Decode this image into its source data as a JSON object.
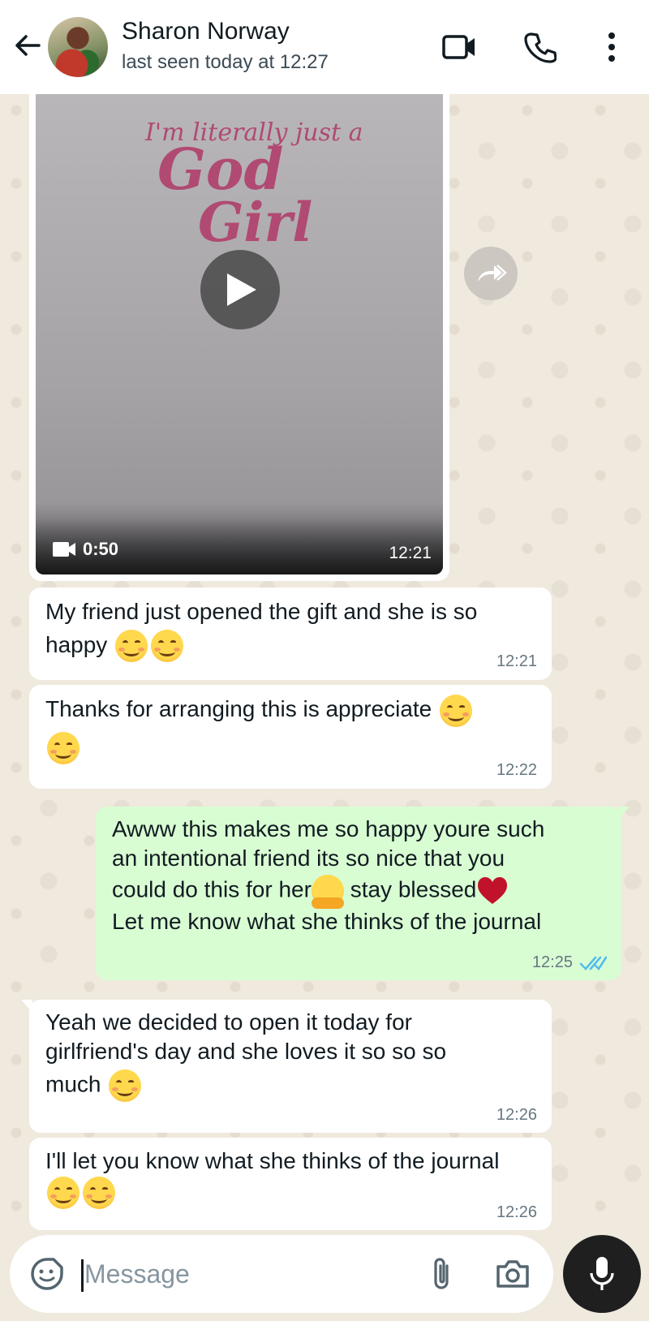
{
  "header": {
    "contact_name": "Sharon Norway",
    "last_seen": "last seen today at 12:27",
    "icons": [
      "back-arrow-icon",
      "video-call-icon",
      "phone-icon",
      "more-options-icon"
    ]
  },
  "messages": [
    {
      "type": "video",
      "direction": "incoming",
      "thumbnail_text": [
        "I'm literally just a",
        "God",
        "Girl"
      ],
      "duration": "0:50",
      "time": "12:21"
    },
    {
      "type": "text",
      "direction": "incoming",
      "text": "My friend just opened the gift and she is so happy",
      "emoji": [
        "smiling-face",
        "smiling-face"
      ],
      "time": "12:21"
    },
    {
      "type": "text",
      "direction": "incoming",
      "text": "Thanks for arranging this is appreciate",
      "emoji": [
        "smiling-face",
        "smiling-face"
      ],
      "time": "12:22"
    },
    {
      "type": "text",
      "direction": "outgoing",
      "line1": "Awww this makes me so happy youre such",
      "line2": "an intentional friend its so nice that you",
      "line3a": "could do this for her",
      "line3b": " stay blessed",
      "line4": "Let me know what she thinks of the journal",
      "emoji": [
        "hugging-face",
        "red-heart"
      ],
      "time": "12:25",
      "status": "read"
    },
    {
      "type": "text",
      "direction": "incoming",
      "line1": "Yeah we decided to open it today for",
      "line2": "girlfriend's day and she loves it so so so",
      "line3": "much",
      "emoji": [
        "smiling-face"
      ],
      "time": "12:26"
    },
    {
      "type": "text",
      "direction": "incoming",
      "text": "I'll let you know what she thinks of the journal",
      "emoji": [
        "smiling-face",
        "smiling-face"
      ],
      "time": "12:26"
    }
  ],
  "composer": {
    "placeholder": "Message",
    "value": ""
  },
  "colors": {
    "chat_background": "#efe9de",
    "incoming_bubble": "#ffffff",
    "outgoing_bubble": "#d9fdd3",
    "read_ticks": "#53bdeb",
    "mic_button": "#1f1f1f"
  }
}
